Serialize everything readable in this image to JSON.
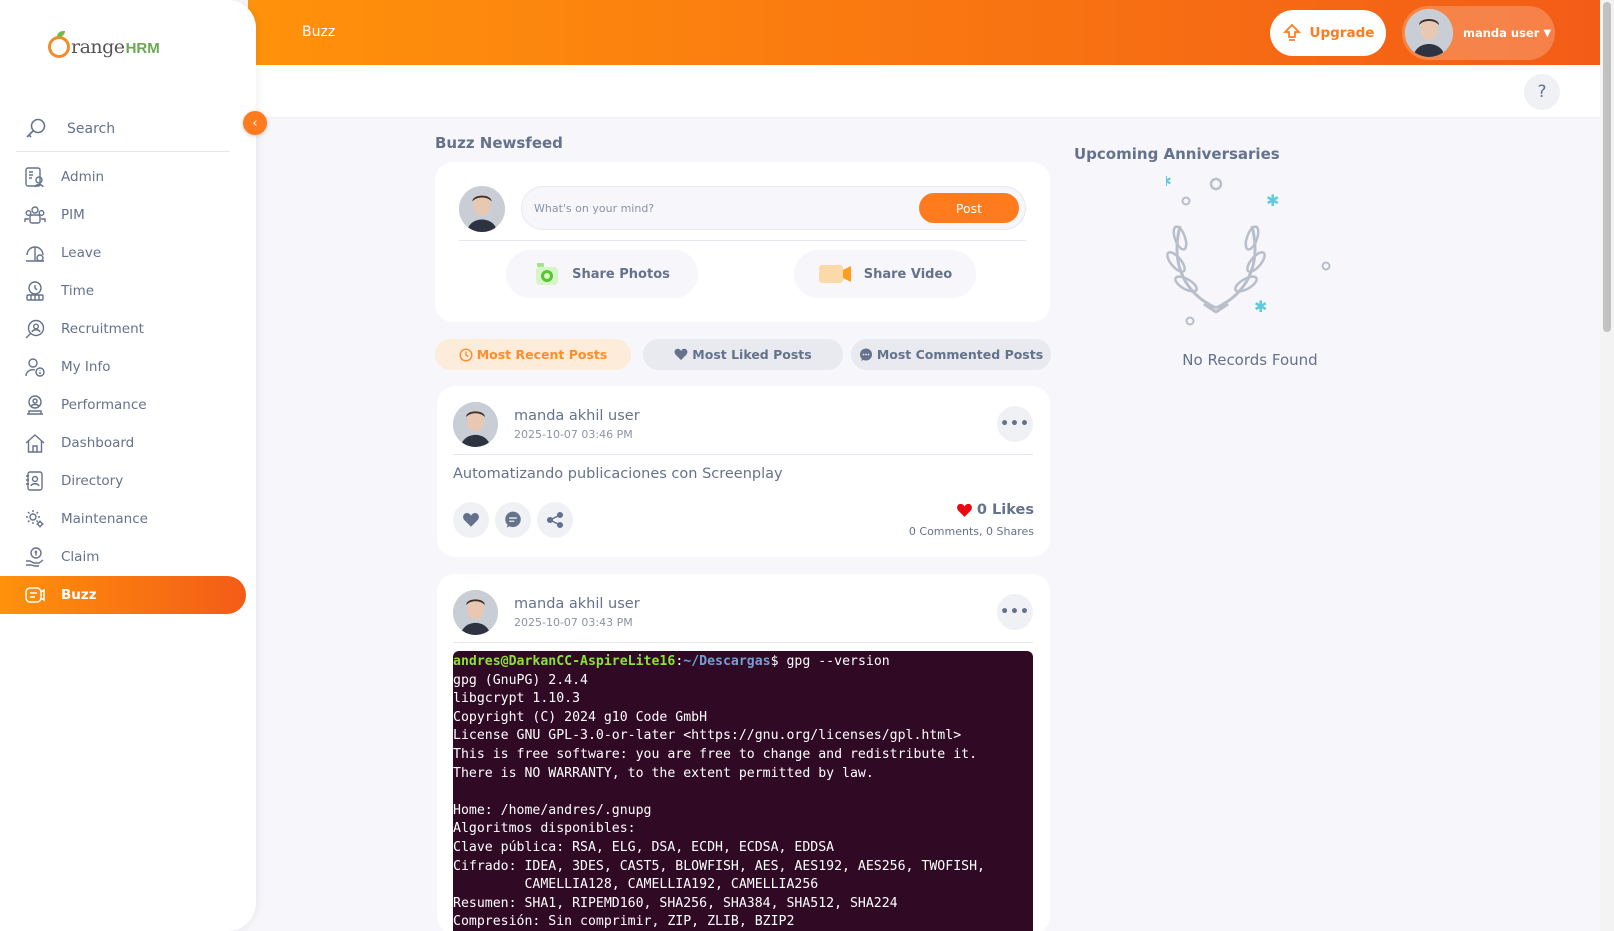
{
  "brand": {
    "orange_text": "range",
    "hrm_text": "HRM"
  },
  "header": {
    "title": "Buzz",
    "upgrade_label": "Upgrade",
    "user_name": "manda user",
    "help_label": "?"
  },
  "sidebar": {
    "search_label": "Search",
    "collapse_glyph": "‹",
    "items": [
      {
        "label": "Admin",
        "icon": "admin-icon"
      },
      {
        "label": "PIM",
        "icon": "pim-icon"
      },
      {
        "label": "Leave",
        "icon": "leave-icon"
      },
      {
        "label": "Time",
        "icon": "time-icon"
      },
      {
        "label": "Recruitment",
        "icon": "recruitment-icon"
      },
      {
        "label": "My Info",
        "icon": "my-info-icon"
      },
      {
        "label": "Performance",
        "icon": "performance-icon"
      },
      {
        "label": "Dashboard",
        "icon": "dashboard-icon"
      },
      {
        "label": "Directory",
        "icon": "directory-icon"
      },
      {
        "label": "Maintenance",
        "icon": "maintenance-icon"
      },
      {
        "label": "Claim",
        "icon": "claim-icon"
      },
      {
        "label": "Buzz",
        "icon": "buzz-icon",
        "active": true
      }
    ]
  },
  "newsfeed": {
    "title": "Buzz Newsfeed",
    "composer": {
      "placeholder": "What's on your mind?",
      "post_label": "Post",
      "share_photos_label": "Share Photos",
      "share_video_label": "Share Video"
    },
    "tabs": {
      "recent": "Most Recent Posts",
      "liked": "Most Liked Posts",
      "commented": "Most Commented Posts"
    },
    "posts": [
      {
        "author": "manda akhil user",
        "time": "2025-10-07 03:46 PM",
        "text": "Automatizando publicaciones con Screenplay",
        "likes": "0 Likes",
        "comments": "0 Comments",
        "shares": "0 Shares"
      },
      {
        "author": "manda akhil user",
        "time": "2025-10-07 03:43 PM",
        "terminal": {
          "prompt_user": "andres@DarkanCC-AspireLite16",
          "prompt_sep": ":",
          "prompt_path": "~/Descargas",
          "prompt_cmd": "$ gpg --version",
          "output": "gpg (GnuPG) 2.4.4\nlibgcrypt 1.10.3\nCopyright (C) 2024 g10 Code GmbH\nLicense GNU GPL-3.0-or-later <https://gnu.org/licenses/gpl.html>\nThis is free software: you are free to change and redistribute it.\nThere is NO WARRANTY, to the extent permitted by law.\n\nHome: /home/andres/.gnupg\nAlgoritmos disponibles:\nClave pública: RSA, ELG, DSA, ECDH, ECDSA, EDDSA\nCifrado: IDEA, 3DES, CAST5, BLOWFISH, AES, AES192, AES256, TWOFISH,\n         CAMELLIA128, CAMELLIA192, CAMELLIA256\nResumen: SHA1, RIPEMD160, SHA256, SHA384, SHA512, SHA224\nCompresión: Sin comprimir, ZIP, ZLIB, BZIP2"
        }
      }
    ]
  },
  "anniversaries": {
    "title": "Upcoming Anniversaries",
    "empty_text": "No Records Found"
  },
  "colors": {
    "accent": "#ff7b1d",
    "gradient_start": "#ff920b",
    "gradient_end": "#f35c17",
    "text": "#64728c",
    "like_heart": "#eb0910",
    "terminal_bg": "#300a24"
  }
}
